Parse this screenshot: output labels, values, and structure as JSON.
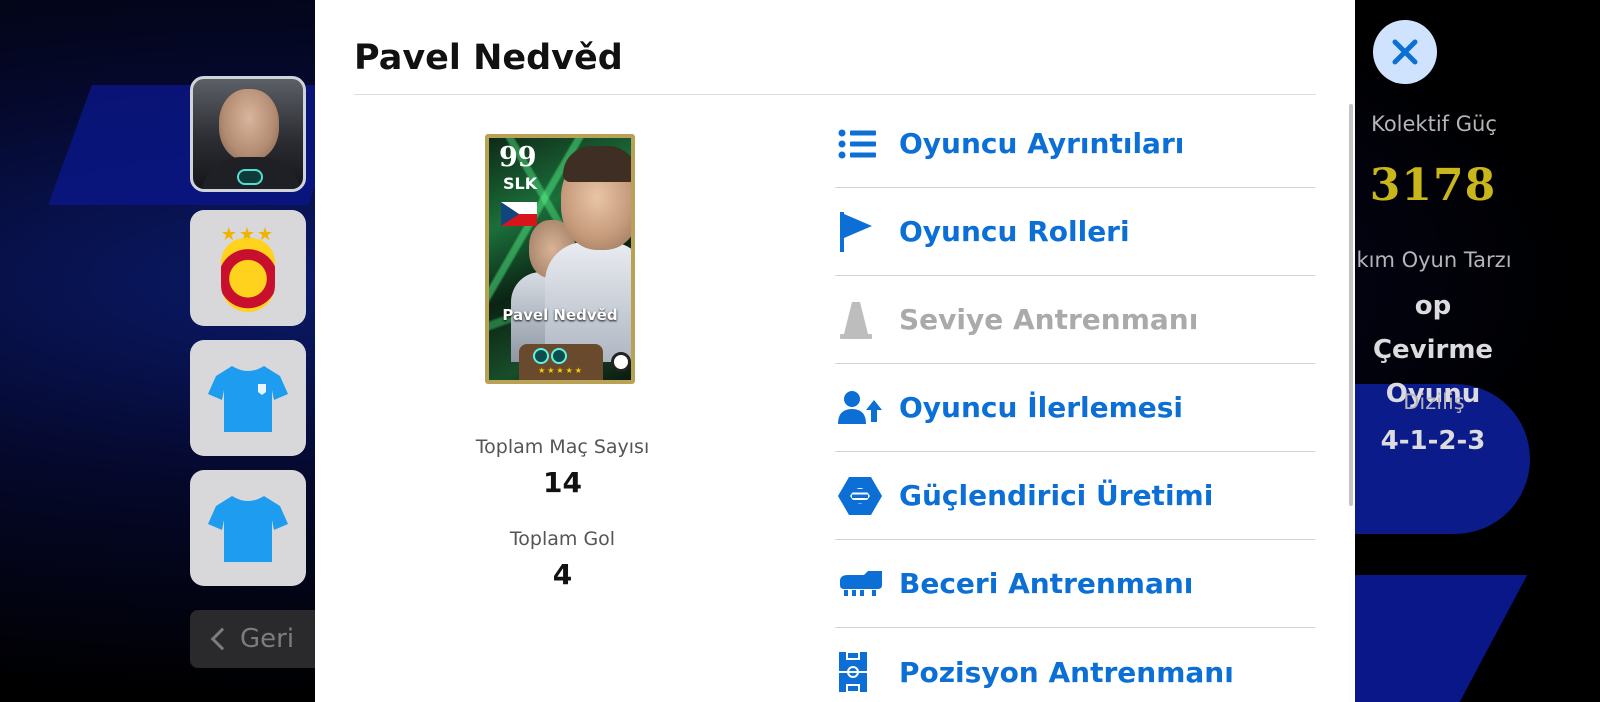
{
  "modal": {
    "player_name": "Pavel Nedvěd",
    "card": {
      "rating": "99",
      "position": "SLK",
      "name": "Pavel Nedvěd",
      "stars": "★★★★★"
    },
    "stats": [
      {
        "label": "Toplam Maç Sayısı",
        "value": "14"
      },
      {
        "label": "Toplam Gol",
        "value": "4"
      }
    ],
    "menu": [
      {
        "label": "Oyuncu Ayrıntıları",
        "icon": "list-icon",
        "enabled": true
      },
      {
        "label": "Oyuncu Rolleri",
        "icon": "flag-icon",
        "enabled": true
      },
      {
        "label": "Seviye Antrenmanı",
        "icon": "training-cone-icon",
        "enabled": false
      },
      {
        "label": "Oyuncu İlerlemesi",
        "icon": "player-progress-icon",
        "enabled": true
      },
      {
        "label": "Güçlendirici Üretimi",
        "icon": "booster-icon",
        "enabled": true
      },
      {
        "label": "Beceri Antrenmanı",
        "icon": "boot-icon",
        "enabled": true
      },
      {
        "label": "Pozisyon Antrenmanı",
        "icon": "pitch-icon",
        "enabled": true
      }
    ]
  },
  "sidebar": {
    "back_label": "Geri",
    "club_stars": "★★★"
  },
  "team_info": {
    "kolektif_label": "Kolektif Güç",
    "kolektif_value": "3178",
    "tarz_label": "kım Oyun Tarzı",
    "tarz_value_line1": "op Çevirme",
    "tarz_value_line2": "Oyunu",
    "dizilis_label": "Diziliş",
    "dizilis_value": "4-1-2-3"
  },
  "colors": {
    "accent_blue": "#0b6fd6",
    "disabled_gray": "#aaaaaa",
    "kolektif_gold": "#c9b61a"
  }
}
